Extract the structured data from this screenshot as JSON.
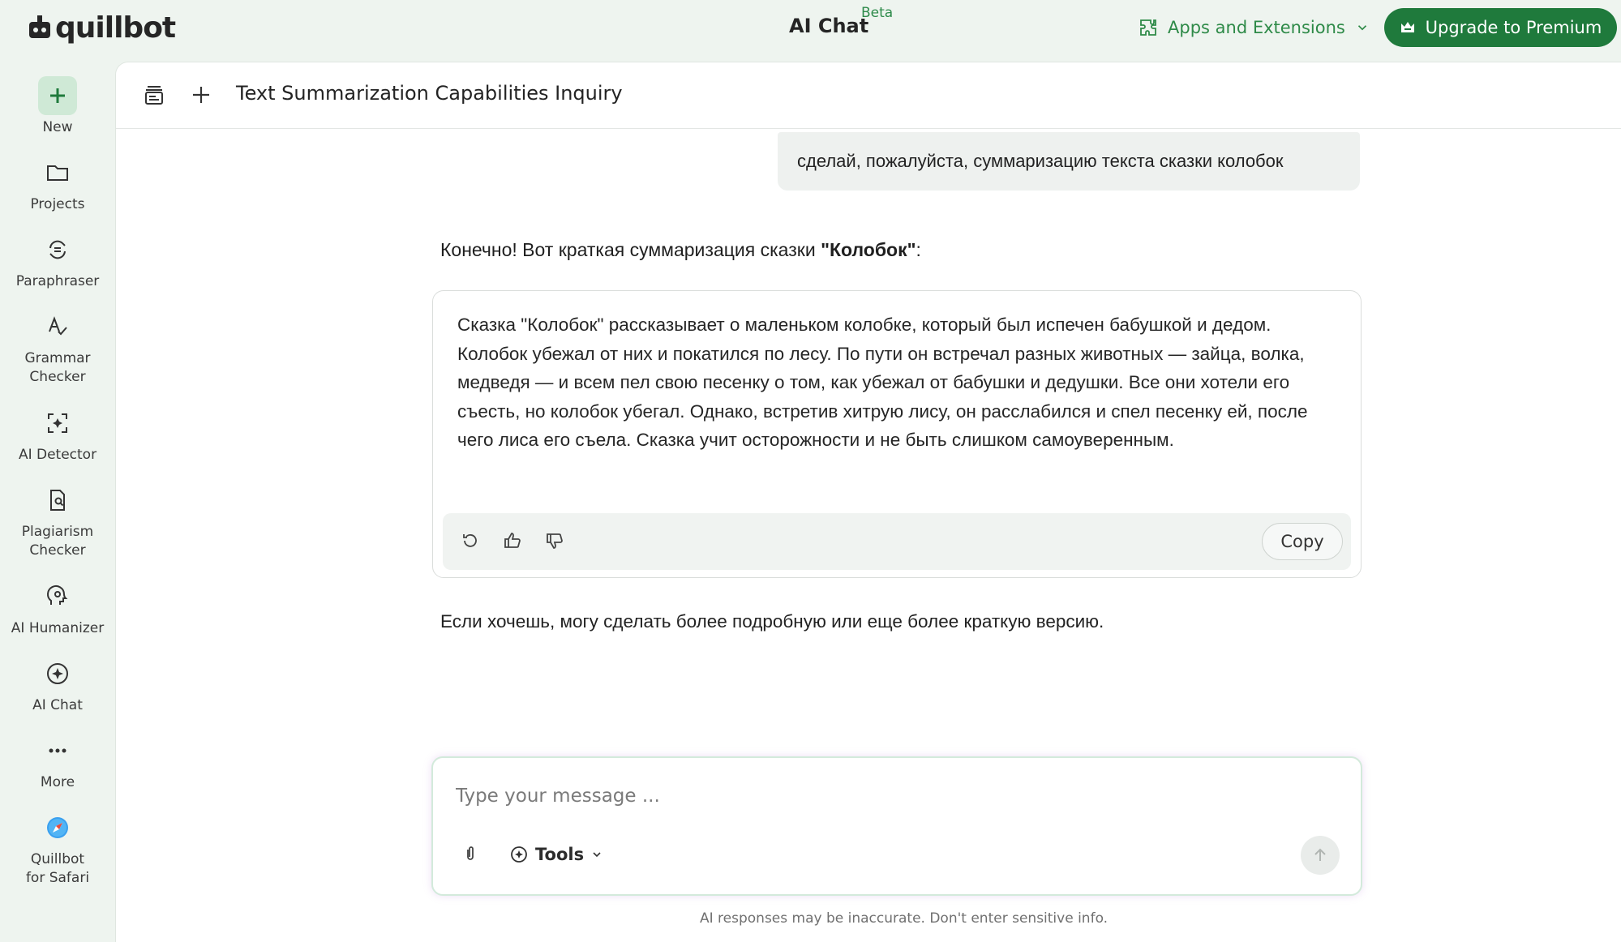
{
  "header": {
    "logo": "quillbot",
    "title": "AI Chat",
    "badge": "Beta",
    "apps_label": "Apps and Extensions",
    "upgrade_label": "Upgrade to Premium"
  },
  "sidebar": {
    "items": [
      {
        "label": "New",
        "icon": "plus-icon"
      },
      {
        "label": "Projects",
        "icon": "folder-icon"
      },
      {
        "label": "Paraphraser",
        "icon": "paraphrase-icon"
      },
      {
        "label": "Grammar Checker",
        "icon": "grammar-icon"
      },
      {
        "label": "AI Detector",
        "icon": "ai-detector-icon"
      },
      {
        "label": "Plagiarism Checker",
        "icon": "plagiarism-icon"
      },
      {
        "label": "AI Humanizer",
        "icon": "humanizer-icon"
      },
      {
        "label": "AI Chat",
        "icon": "ai-chat-icon"
      },
      {
        "label": "More",
        "icon": "more-icon"
      },
      {
        "label": "Quillbot for Safari",
        "icon": "safari-icon"
      }
    ]
  },
  "conversation": {
    "title": "Text Summarization Capabilities Inquiry",
    "user_message": "сделай, пожалуйста, суммаризацию текста сказки колобок",
    "intro_prefix": "Конечно! Вот краткая суммаризация сказки ",
    "intro_bold": "\"Колобок\"",
    "intro_suffix": ":",
    "summary": "Сказка \"Колобок\" рассказывает о маленьком колобке, который был испечен бабушкой и дедом. Колобок убежал от них и покатился по лесу. По пути он встречал разных животных — зайца, волка, медведя — и всем пел свою песенку о том, как убежал от бабушки и дедушки. Все они хотели его съесть, но колобок убегал. Однако, встретив хитрую лису, он расслабился и спел песенку ей, после чего лиса его съела. Сказка учит осторожности и не быть слишком самоуверенным.",
    "copy_label": "Copy",
    "followup": "Если хочешь, могу сделать более подробную или еще более краткую версию."
  },
  "composer": {
    "placeholder": "Type your message ...",
    "tools_label": "Tools"
  },
  "footer": {
    "disclaimer": "AI responses may be inaccurate. Don't enter sensitive info."
  },
  "colors": {
    "brand_green": "#1f7a3c",
    "accent_green": "#2e8a48",
    "background": "#eef4ef"
  }
}
